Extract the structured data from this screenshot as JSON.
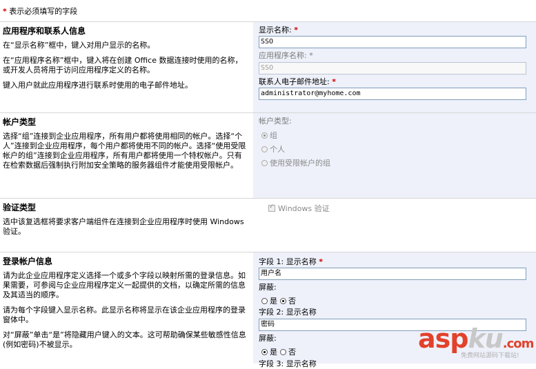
{
  "required_note": "表示必须填写的字段",
  "required_star": "*",
  "app": {
    "title": "应用程序和联系人信息",
    "desc": [
      "在“显示名称”框中，键入对用户显示的名称。",
      "在“应用程序名称”框中，键入将在创建 Office 数据连接时使用的名称，或开发人员将用于访问应用程序定义的名称。",
      "键入用户就此应用程序进行联系时使用的电子邮件地址。"
    ],
    "display_name_label": "显示名称:",
    "display_name_value": "SSO",
    "app_name_label": "应用程序名称:",
    "app_name_value": "SSO",
    "email_label": "联系人电子邮件地址:",
    "email_value": "administrator@myhome.com"
  },
  "account": {
    "title": "帐户类型",
    "desc": "选择“组”连接到企业应用程序，所有用户都将使用相同的帐户。选择“个人”连接到企业应用程序，每个用户都将使用不同的帐户。选择“使用受限帐户的组”连接到企业应用程序，所有用户都将使用一个特权帐户。只有在检索数据后强制执行附加安全策略的服务器组件才能使用受限帐户。",
    "type_label": "帐户类型:",
    "options": [
      "组",
      "个人",
      "使用受限帐户的组"
    ],
    "selected": "组"
  },
  "auth": {
    "title": "验证类型",
    "desc": "选中该复选框将要求客户端组件在连接到企业应用程序时使用 Windows 验证。",
    "checkbox_label": "Windows 验证",
    "checked": true
  },
  "logon": {
    "title": "登录帐户信息",
    "desc": [
      "请为此企业应用程序定义选择一个或多个字段以映射所需的登录信息。如果需要，可参阅与企业应用程序定义一起提供的文档，以确定所需的信息及其适当的顺序。",
      "请为每个字段键入显示名称。此显示名称将显示在该企业应用程序的登录窗体中。",
      "对“屏蔽”单击“是”将隐藏用户键入的文本。这可帮助确保某些敏感性信息(例如密码)不被显示。"
    ],
    "field1_label": "字段 1: 显示名称",
    "field1_value": "用户名",
    "mask_label": "屏蔽:",
    "yes": "是",
    "no": "否",
    "field1_mask": "否",
    "field2_label": "字段 2: 显示名称",
    "field2_value": "密码",
    "field2_mask": "是",
    "field3_label": "字段 3: 显示名称"
  },
  "watermark": {
    "brand_asp": "asp",
    "brand_ku": "ku",
    "brand_domain": ".com",
    "subtitle": "免费网站源码下载站!"
  }
}
